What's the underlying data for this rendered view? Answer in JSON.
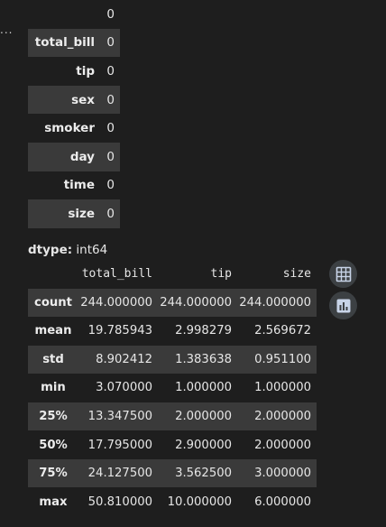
{
  "null_counts": {
    "column_header": "0",
    "rows": [
      {
        "label": "total_bill",
        "value": "0"
      },
      {
        "label": "tip",
        "value": "0"
      },
      {
        "label": "sex",
        "value": "0"
      },
      {
        "label": "smoker",
        "value": "0"
      },
      {
        "label": "day",
        "value": "0"
      },
      {
        "label": "time",
        "value": "0"
      },
      {
        "label": "size",
        "value": "0"
      }
    ],
    "dtype_label": "dtype:",
    "dtype_value": " int64"
  },
  "describe": {
    "columns": [
      "total_bill",
      "tip",
      "size"
    ],
    "rows": [
      {
        "label": "count",
        "values": [
          "244.000000",
          "244.000000",
          "244.000000"
        ]
      },
      {
        "label": "mean",
        "values": [
          "19.785943",
          "2.998279",
          "2.569672"
        ]
      },
      {
        "label": "std",
        "values": [
          "8.902412",
          "1.383638",
          "0.951100"
        ]
      },
      {
        "label": "min",
        "values": [
          "3.070000",
          "1.000000",
          "1.000000"
        ]
      },
      {
        "label": "25%",
        "values": [
          "13.347500",
          "2.000000",
          "2.000000"
        ]
      },
      {
        "label": "50%",
        "values": [
          "17.795000",
          "2.900000",
          "2.000000"
        ]
      },
      {
        "label": "75%",
        "values": [
          "24.127500",
          "3.562500",
          "3.000000"
        ]
      },
      {
        "label": "max",
        "values": [
          "50.810000",
          "10.000000",
          "6.000000"
        ]
      }
    ]
  },
  "toolbar": {
    "ellipsis": "...",
    "icons": [
      "table-icon",
      "chart-icon"
    ]
  },
  "colors": {
    "background": "#1e1e1e",
    "stripe": "#3a3a3a",
    "button_bg": "#3c4043",
    "icon": "#c8d4e8"
  }
}
